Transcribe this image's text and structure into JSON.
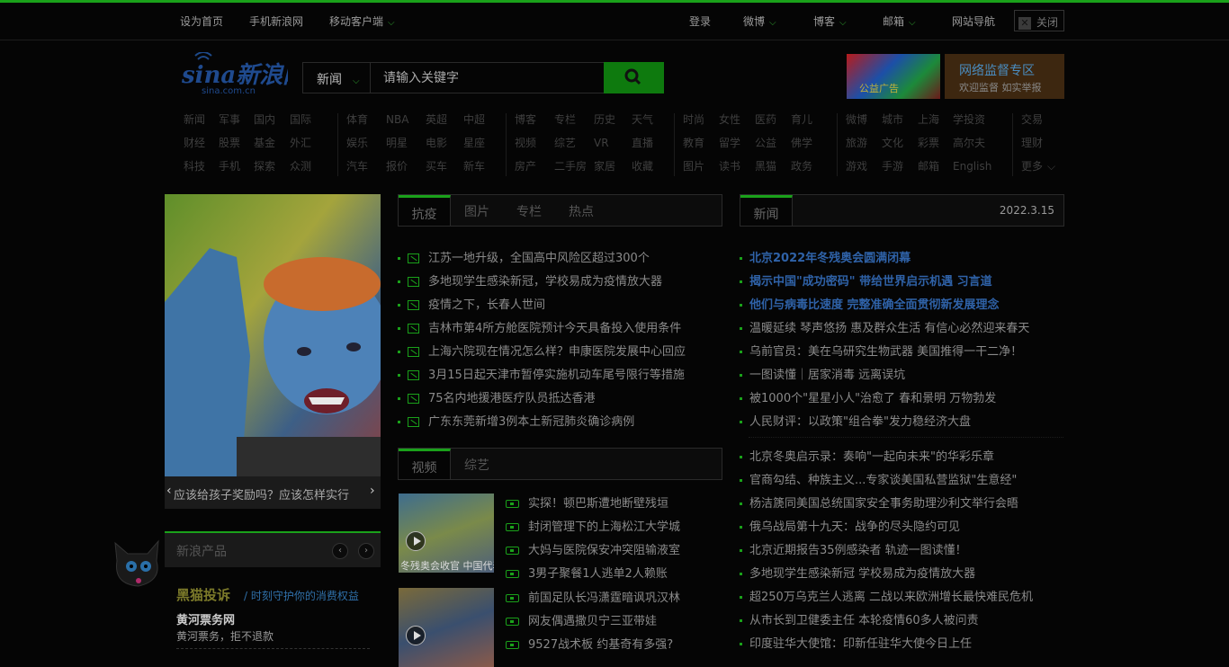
{
  "topbar": {
    "left": [
      "设为首页",
      "手机新浪网",
      "移动客户端"
    ],
    "right": [
      "登录",
      "微博",
      "博客",
      "邮箱",
      "网站导航"
    ],
    "close": "关闭"
  },
  "logo": {
    "text": "sina新浪网",
    "sub": "sina.com.cn"
  },
  "search": {
    "category": "新闻",
    "placeholder": "请输入关键字"
  },
  "ads": {
    "ad1": "公益广告",
    "ad2_title": "网络监督专区",
    "ad2_sub": "欢迎监督 如实举报"
  },
  "nav": [
    [
      [
        "新闻",
        "军事",
        "国内",
        "国际"
      ],
      [
        "财经",
        "股票",
        "基金",
        "外汇"
      ],
      [
        "科技",
        "手机",
        "探索",
        "众测"
      ]
    ],
    [
      [
        "体育",
        "NBA",
        "英超",
        "中超"
      ],
      [
        "娱乐",
        "明星",
        "电影",
        "星座"
      ],
      [
        "汽车",
        "报价",
        "买车",
        "新车"
      ]
    ],
    [
      [
        "博客",
        "专栏",
        "历史",
        "天气"
      ],
      [
        "视频",
        "综艺",
        "VR",
        "直播"
      ],
      [
        "房产",
        "二手房",
        "家居",
        "收藏"
      ]
    ],
    [
      [
        "时尚",
        "女性",
        "医药",
        "育儿"
      ],
      [
        "教育",
        "留学",
        "公益",
        "佛学"
      ],
      [
        "图片",
        "读书",
        "黑猫",
        "政务"
      ]
    ],
    [
      [
        "微博",
        "城市",
        "上海",
        "学投资"
      ],
      [
        "旅游",
        "文化",
        "彩票",
        "高尔夫"
      ],
      [
        "游戏",
        "手游",
        "邮箱",
        "English"
      ]
    ],
    [
      [
        "交易"
      ],
      [
        "理财"
      ],
      [
        "更多"
      ]
    ]
  ],
  "slider": {
    "caption": "应该给孩子奖励吗？应该怎样实行"
  },
  "product": {
    "title": "新浪产品",
    "brand": "黑猫投诉",
    "slogan": "/ 时刻守护你的消费权益",
    "item_title": "黄河票务网",
    "item_desc": "黄河票务，拒不退款"
  },
  "mid_tabs": [
    "抗疫",
    "图片",
    "专栏",
    "热点"
  ],
  "mid_news": [
    "江苏一地升级，全国高中风险区超过300个",
    "多地现学生感染新冠，学校易成为疫情放大器",
    "疫情之下，长春人世间",
    "吉林市第4所方舱医院预计今天具备投入使用条件",
    "上海六院现在情况怎么样？申康医院发展中心回应",
    "3月15日起天津市暂停实施机动车尾号限行等措施",
    "75名内地援港医疗队员抵达香港",
    "广东东莞新增3例本土新冠肺炎确诊病例"
  ],
  "video_tabs": [
    "视频",
    "综艺"
  ],
  "video_thumbs": [
    "冬残奥会收官 中国代表团名列第一",
    ""
  ],
  "video_news": [
    "实探！顿巴斯遭地断壁残垣",
    "封闭管理下的上海松江大学城",
    "大妈与医院保安冲突阻输液室",
    "3男子聚餐1人逃单2人赖账",
    "前国足队长冯潇霆暗讽巩汉林",
    "网友偶遇撒贝宁三亚带娃",
    "9527战术板 约基奇有多强?"
  ],
  "right_tab": {
    "label": "新闻",
    "date": "2022.3.15"
  },
  "right_news_hl": [
    "北京2022年冬残奥会圆满闭幕",
    "揭示中国\"成功密码\" 带给世界启示机遇 习言道",
    "他们与病毒比速度 完整准确全面贯彻新发展理念"
  ],
  "right_news_a": [
    "温暖延续 琴声悠扬 惠及群众生活 有信心必然迎来春天",
    "乌前官员：美在乌研究生物武器 美国推得一干二净！",
    "一图读懂｜居家消毒 远离误坑",
    "被1000个\"星星小人\"治愈了 春和景明 万物勃发",
    "人民财评：以政策\"组合拳\"发力稳经济大盘"
  ],
  "right_news_b": [
    "北京冬奥启示录：奏响\"一起向未来\"的华彩乐章",
    "官商勾结、种族主义...专家谈美国私营监狱\"生意经\"",
    "杨洁篪同美国总统国家安全事务助理沙利文举行会晤",
    "俄乌战局第十九天：战争的尽头隐约可见",
    "北京近期报告35例感染者 轨迹一图读懂！",
    "多地现学生感染新冠 学校易成为疫情放大器",
    "超250万乌克兰人逃离 二战以来欧洲增长最快难民危机",
    "从市长到卫健委主任 本轮疫情60多人被问责",
    "印度驻华大使馆：印新任驻华大使今日上任"
  ]
}
